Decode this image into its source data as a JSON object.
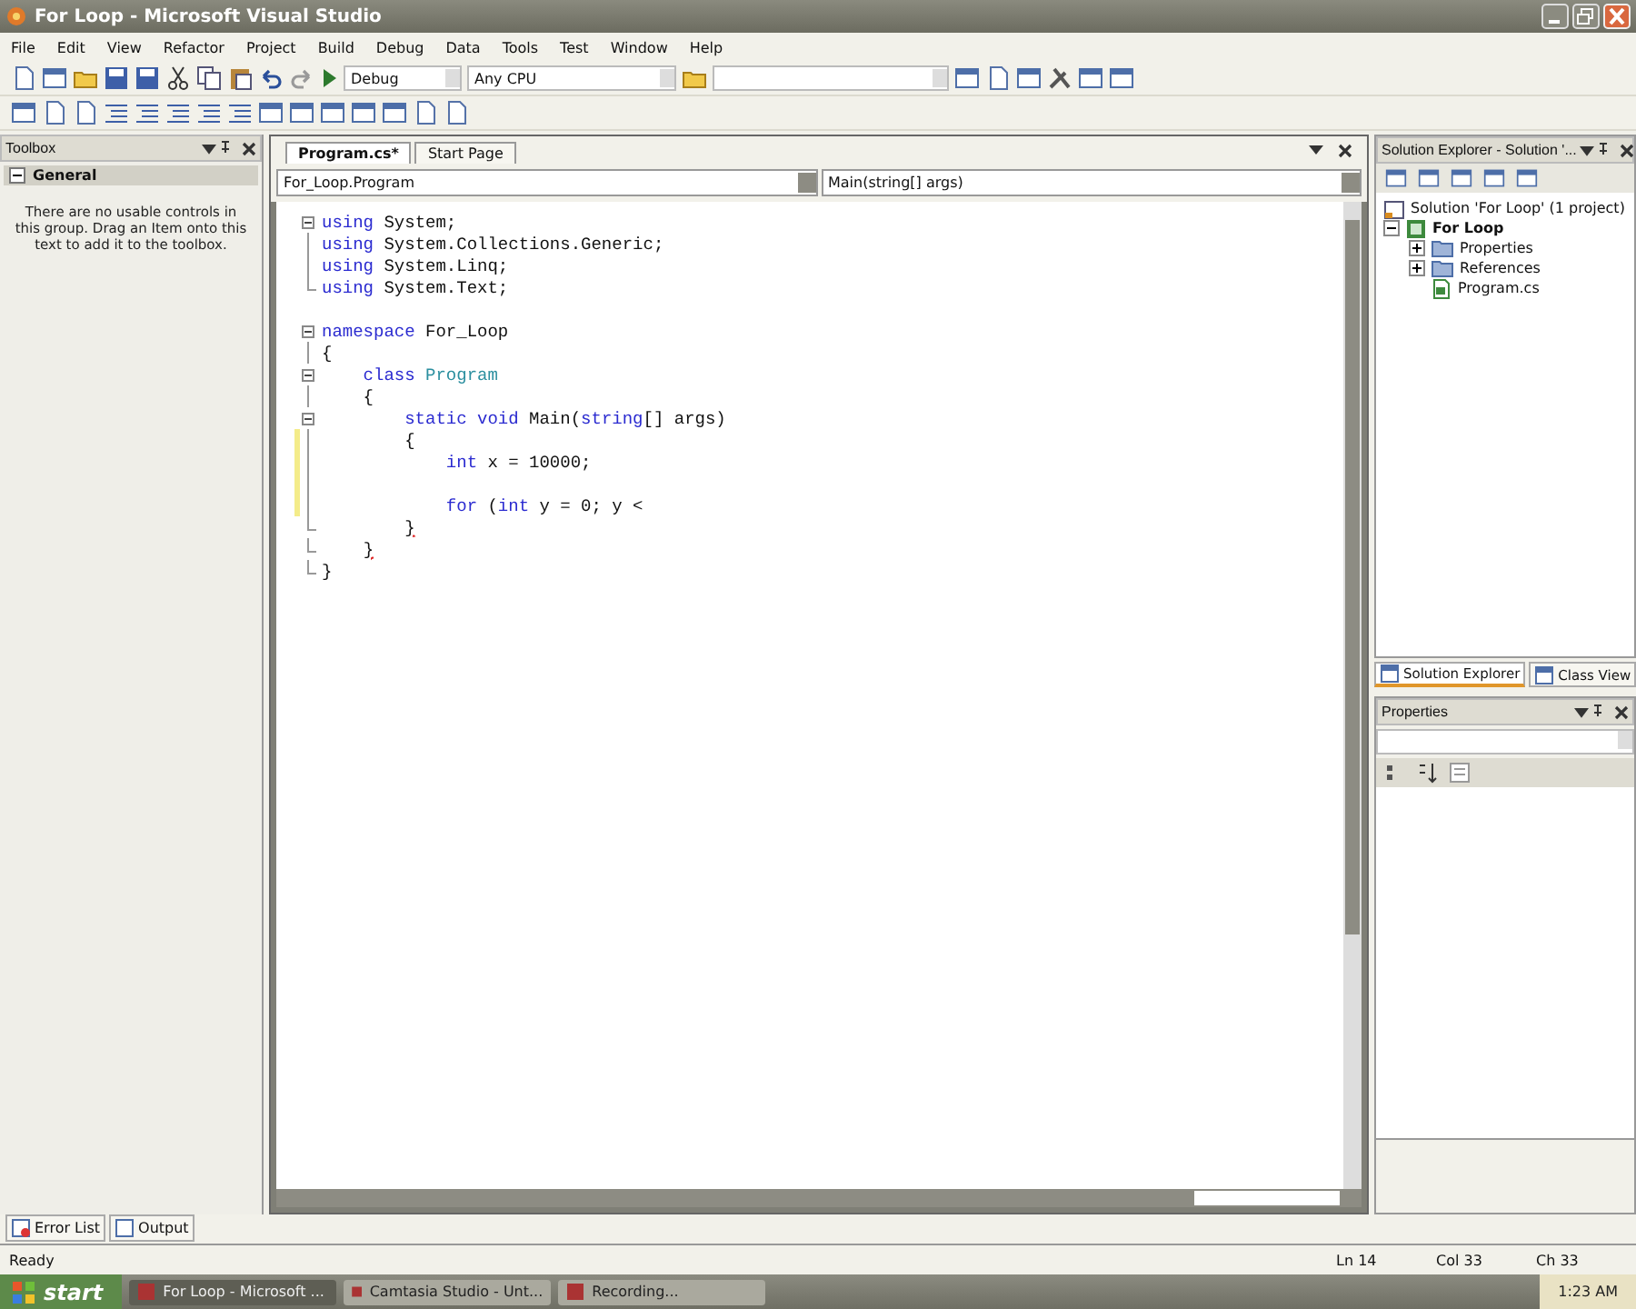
{
  "window": {
    "title": "For Loop - Microsoft Visual Studio"
  },
  "menu": [
    "File",
    "Edit",
    "View",
    "Refactor",
    "Project",
    "Build",
    "Debug",
    "Data",
    "Tools",
    "Test",
    "Window",
    "Help"
  ],
  "toolbar": {
    "configuration": "Debug",
    "platform": "Any CPU"
  },
  "toolbox": {
    "title": "Toolbox",
    "group": {
      "label": "General",
      "expanded": true
    },
    "message": "There are no usable controls in this group. Drag an Item onto this text to add it to the toolbox."
  },
  "editor": {
    "tabs": [
      {
        "label": "Program.cs*",
        "selected": true
      },
      {
        "label": "Start Page",
        "selected": false
      }
    ],
    "type_selector": "For_Loop.Program",
    "member_selector": "Main(string[] args)",
    "lines": [
      {
        "kind": "fold",
        "changed": false,
        "tokens": [
          {
            "kind": "keyword",
            "text": "using"
          },
          {
            "kind": "plain",
            "text": " System;"
          }
        ]
      },
      {
        "kind": "guide",
        "changed": false,
        "tokens": [
          {
            "kind": "keyword",
            "text": "using"
          },
          {
            "kind": "plain",
            "text": " System.Collections.Generic;"
          }
        ]
      },
      {
        "kind": "guide",
        "changed": false,
        "tokens": [
          {
            "kind": "keyword",
            "text": "using"
          },
          {
            "kind": "plain",
            "text": " System.Linq;"
          }
        ]
      },
      {
        "kind": "fold_end",
        "changed": false,
        "tokens": [
          {
            "kind": "keyword",
            "text": "using"
          },
          {
            "kind": "plain",
            "text": " System.Text;"
          }
        ]
      },
      {
        "kind": "blank",
        "changed": false
      },
      {
        "kind": "fold",
        "changed": false,
        "tokens": [
          {
            "kind": "keyword",
            "text": "namespace"
          },
          {
            "kind": "plain",
            "text": " For_Loop"
          }
        ]
      },
      {
        "kind": "guide",
        "changed": false,
        "tokens": [
          {
            "kind": "plain",
            "text": "{"
          }
        ]
      },
      {
        "kind": "fold",
        "changed": false,
        "tokens": [
          {
            "kind": "keyword",
            "text": "    class "
          },
          {
            "kind": "type",
            "text": "Program"
          }
        ]
      },
      {
        "kind": "guide",
        "changed": false,
        "tokens": [
          {
            "kind": "plain",
            "text": "    {"
          }
        ]
      },
      {
        "kind": "fold",
        "changed": false,
        "tokens": [
          {
            "kind": "keyword",
            "text": "        static void"
          },
          {
            "kind": "plain",
            "text": " Main("
          },
          {
            "kind": "keyword",
            "text": "string"
          },
          {
            "kind": "plain",
            "text": "[] args)"
          }
        ]
      },
      {
        "kind": "guide",
        "changed": true,
        "tokens": [
          {
            "kind": "plain",
            "text": "        {"
          }
        ]
      },
      {
        "kind": "guide",
        "changed": true,
        "tokens": [
          {
            "kind": "keyword",
            "text": "            int"
          },
          {
            "kind": "plain",
            "text": " x = 10000;"
          }
        ]
      },
      {
        "kind": "guide",
        "changed": true
      },
      {
        "kind": "guide",
        "changed": true,
        "tokens": [
          {
            "kind": "keyword",
            "text": "            for"
          },
          {
            "kind": "plain",
            "text": " ("
          },
          {
            "kind": "keyword",
            "text": "int"
          },
          {
            "kind": "plain",
            "text": " y = 0; y <"
          }
        ]
      },
      {
        "kind": "fold_end",
        "changed": false,
        "tokens": [
          {
            "kind": "error",
            "text": "        }"
          }
        ]
      },
      {
        "kind": "fold_end",
        "changed": false,
        "tokens": [
          {
            "kind": "error",
            "text": "    }"
          }
        ]
      },
      {
        "kind": "fold_end",
        "changed": false,
        "tokens": [
          {
            "kind": "plain",
            "text": "}"
          }
        ]
      }
    ]
  },
  "solution_explorer": {
    "title": "Solution Explorer - Solution '...",
    "solution": "Solution 'For Loop' (1 project)",
    "projects": [
      {
        "label": "For Loop",
        "expanded": true,
        "children": [
          {
            "label": "Properties",
            "kind": "folder",
            "expanded": false
          },
          {
            "label": "References",
            "kind": "folder",
            "expanded": false
          },
          {
            "label": "Program.cs",
            "kind": "file"
          }
        ]
      }
    ],
    "tabs": [
      {
        "label": "Solution Explorer",
        "selected": true
      },
      {
        "label": "Class View",
        "selected": false
      }
    ]
  },
  "properties": {
    "title": "Properties"
  },
  "bottom_tabs": [
    "Error List",
    "Output"
  ],
  "status_bar": {
    "message": "Ready",
    "line": "Ln 14",
    "column": "Col 33",
    "char": "Ch 33"
  },
  "taskbar": {
    "start": "start",
    "buttons": [
      {
        "label": "For Loop - Microsoft ...",
        "selected": true
      },
      {
        "label": "Camtasia Studio - Unt...",
        "selected": false
      },
      {
        "label": "Recording...",
        "selected": false
      }
    ],
    "clock": "1:23 AM"
  }
}
